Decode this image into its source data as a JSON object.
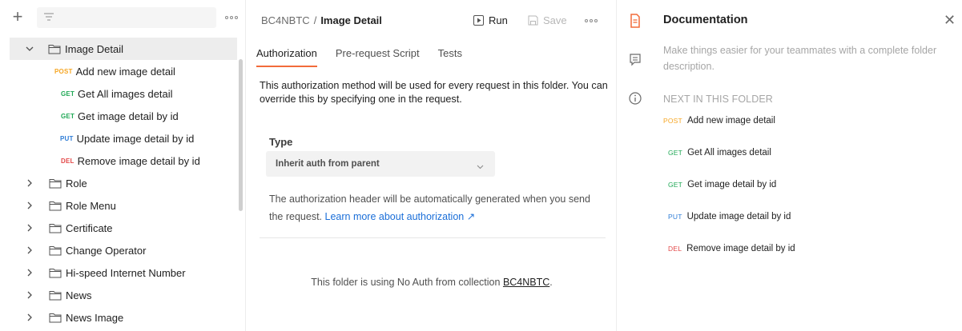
{
  "sidebar": {
    "filter_placeholder": "",
    "selected_folder": "Image Detail",
    "requests": [
      {
        "method": "POST",
        "label": "Add new image detail"
      },
      {
        "method": "GET",
        "label": "Get All images detail"
      },
      {
        "method": "GET",
        "label": "Get image detail by id"
      },
      {
        "method": "PUT",
        "label": "Update image detail by id"
      },
      {
        "method": "DEL",
        "label": "Remove image detail by id"
      }
    ],
    "folders": [
      "Role",
      "Role Menu",
      "Certificate",
      "Change Operator",
      "Hi-speed Internet Number",
      "News",
      "News Image"
    ]
  },
  "header": {
    "collection": "BC4NBTC",
    "separator": "/",
    "current": "Image Detail",
    "run_label": "Run",
    "save_label": "Save"
  },
  "tabs": [
    "Authorization",
    "Pre-request Script",
    "Tests"
  ],
  "auth": {
    "description": "This authorization method will be used for every request in this folder. You can override this by specifying one in the request.",
    "type_label": "Type",
    "type_value": "Inherit auth from parent",
    "note": "The authorization header will be automatically generated when you send the request.",
    "learn_more": "Learn more about authorization ↗",
    "noauth_prefix": "This folder is using No Auth from collection",
    "noauth_collection": "BC4NBTC",
    "noauth_suffix": "."
  },
  "doc": {
    "title": "Documentation",
    "description": "Make things easier for your teammates with a complete folder description.",
    "next_label": "NEXT IN THIS FOLDER",
    "items": [
      {
        "method": "POST",
        "label": "Add new image detail"
      },
      {
        "method": "GET",
        "label": "Get All images detail"
      },
      {
        "method": "GET",
        "label": "Get image detail by id"
      },
      {
        "method": "PUT",
        "label": "Update image detail by id"
      },
      {
        "method": "DEL",
        "label": "Remove image detail by id"
      }
    ]
  },
  "colors": {
    "post": "#f6a623",
    "get": "#1fa855",
    "put": "#2e7cd6",
    "del": "#e34a4a",
    "active_tab": "#f26b3a",
    "link": "#1a6ed8"
  }
}
